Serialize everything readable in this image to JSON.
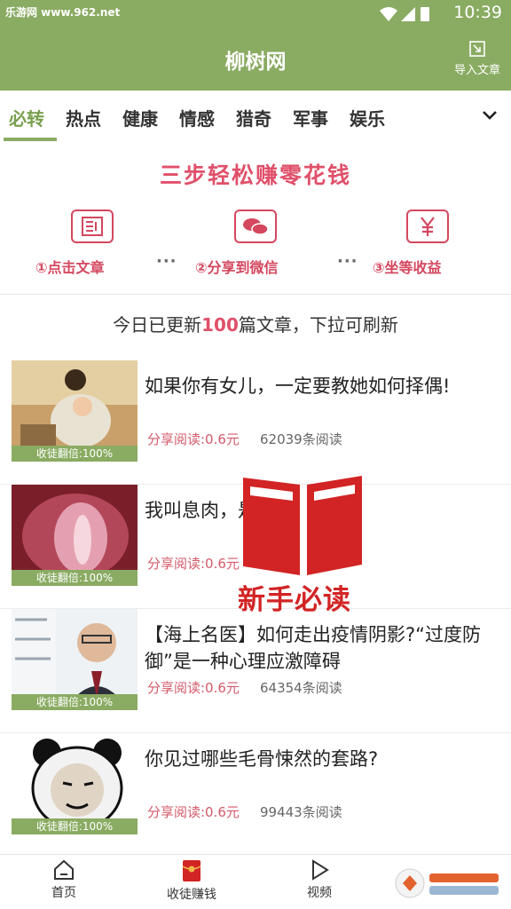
{
  "status_bar": {
    "watermark": "乐游网 www.962.net",
    "time": "10:39",
    "icons": [
      "wifi-icon",
      "signal-icon",
      "battery-icon"
    ]
  },
  "app_bar": {
    "title": "柳树网",
    "import_label": "导入文章",
    "import_icon": "import-icon"
  },
  "tabs": {
    "items": [
      "必转",
      "热点",
      "健康",
      "情感",
      "猎奇",
      "军事",
      "娱乐"
    ],
    "active_index": 0,
    "more_icon": "chevron-down-icon"
  },
  "banner": {
    "headline": "三步轻松赚零花钱",
    "steps": [
      {
        "label": "①点击文章",
        "icon": "article-icon"
      },
      {
        "label": "②分享到微信",
        "icon": "wechat-icon"
      },
      {
        "label": "③坐等收益",
        "icon": "yen-icon"
      }
    ],
    "separator": "···"
  },
  "updated_line": {
    "before": "今日已更新",
    "count": "100",
    "after": "篇文章，下拉可刷新"
  },
  "articles": [
    {
      "title": "如果你有女儿，一定要教她如何择偶!",
      "badge": "收徒翻倍:100%",
      "reward": "分享阅读:0.6元",
      "reads": "62039条阅读"
    },
    {
      "title": "我叫息肉，是",
      "badge": "收徒翻倍:100%",
      "reward": "分享阅读:0.6元",
      "reads": ""
    },
    {
      "title": "【海上名医】如何走出疫情阴影?“过度防御”是一种心理应激障碍",
      "badge": "收徒翻倍:100%",
      "reward": "分享阅读:0.6元",
      "reads": "64354条阅读"
    },
    {
      "title": "你见过哪些毛骨悚然的套路?",
      "badge": "收徒翻倍:100%",
      "reward": "分享阅读:0.6元",
      "reads": "99443条阅读"
    }
  ],
  "overlay": {
    "label": "新手必读",
    "icon": "book-icon"
  },
  "bottom_nav": {
    "items": [
      {
        "label": "首页",
        "icon": "home-icon"
      },
      {
        "label": "收徒赚钱",
        "icon": "red-envelope-icon"
      },
      {
        "label": "视频",
        "icon": "play-icon"
      }
    ]
  },
  "colors": {
    "brand_green": "#8aab62",
    "accent_red": "#d4475f",
    "overlay_red": "#d22424"
  }
}
